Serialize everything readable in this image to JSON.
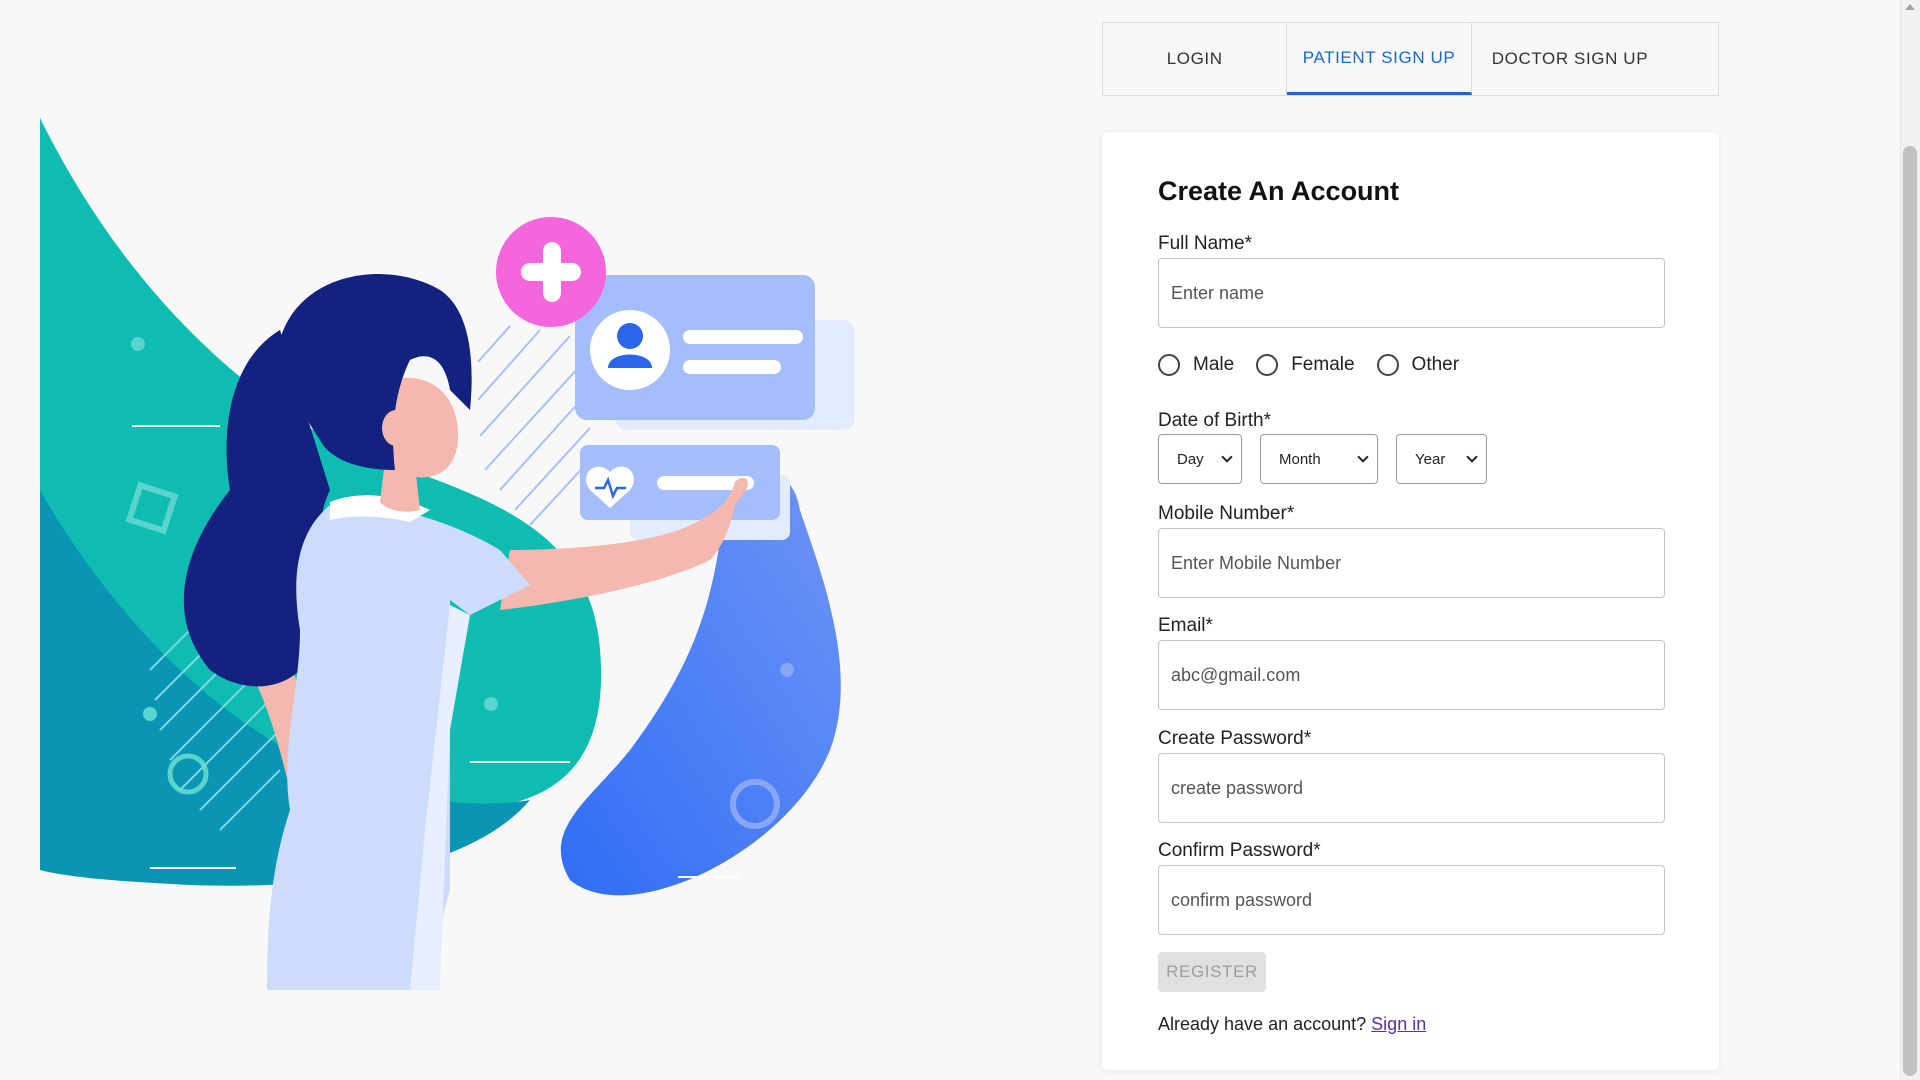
{
  "tabs": [
    {
      "label": "LOGIN",
      "active": false
    },
    {
      "label": "PATIENT SIGN UP",
      "active": true
    },
    {
      "label": "DOCTOR SIGN UP",
      "active": false
    }
  ],
  "form": {
    "title": "Create An Account",
    "full_name": {
      "label": "Full Name*",
      "placeholder": "Enter name",
      "value": ""
    },
    "gender": {
      "options": [
        "Male",
        "Female",
        "Other"
      ],
      "selected": null
    },
    "dob": {
      "label": "Date of Birth*",
      "day": "Day",
      "month": "Month",
      "year": "Year"
    },
    "mobile": {
      "label": "Mobile Number*",
      "placeholder": "Enter Mobile Number",
      "value": ""
    },
    "email": {
      "label": "Email*",
      "placeholder": "abc@gmail.com",
      "value": ""
    },
    "password": {
      "label": "Create Password*",
      "placeholder": "create password",
      "value": ""
    },
    "confirm_password": {
      "label": "Confirm Password*",
      "placeholder": "confirm password",
      "value": ""
    },
    "register_label": "REGISTER",
    "signin_prompt": "Already have an account?",
    "signin_link": "Sign in"
  },
  "colors": {
    "accent": "#1769c7",
    "teal": "#0fbcb2",
    "teal_dark": "#0a95b4",
    "blue": "#4d86f5",
    "pink": "#f565dc",
    "navy": "#14227f",
    "link": "#5a2ea6"
  },
  "icons": [
    "plus-icon",
    "user-icon",
    "heart-pulse-icon"
  ]
}
